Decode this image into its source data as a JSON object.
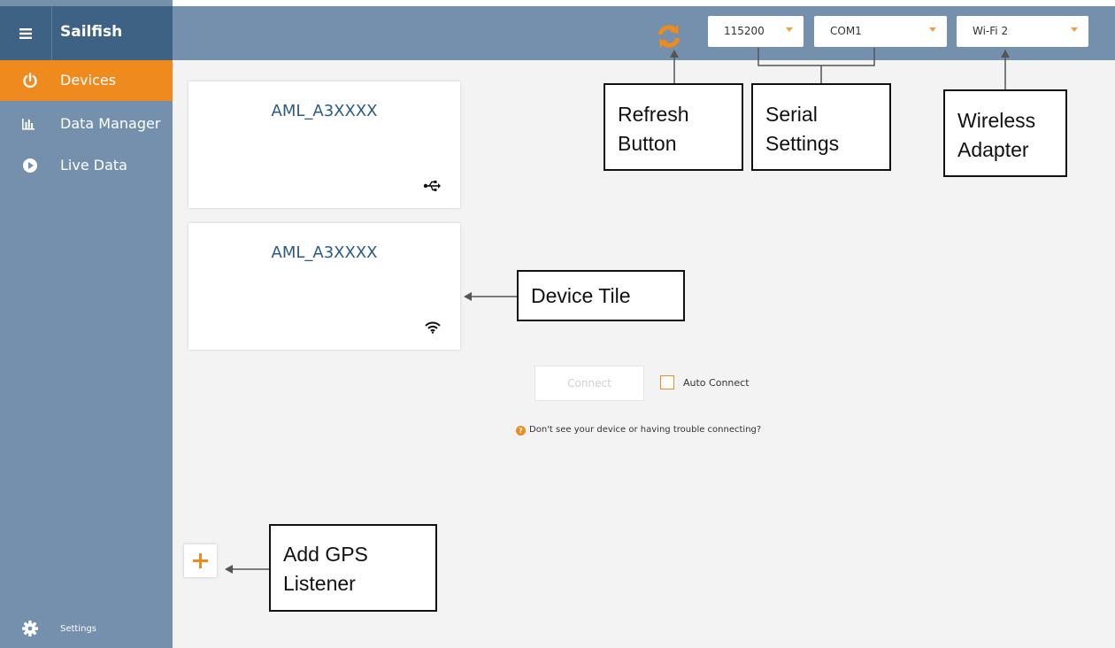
{
  "app": {
    "title": "Sailfish"
  },
  "sidebar": {
    "items": [
      {
        "label": "Devices",
        "icon": "power-icon",
        "active": true
      },
      {
        "label": "Data Manager",
        "icon": "bar-chart-icon",
        "active": false
      },
      {
        "label": "Live Data",
        "icon": "play-icon",
        "active": false
      }
    ],
    "settings_label": "Settings"
  },
  "toolbar": {
    "baud_rate": "115200",
    "com_port": "COM1",
    "wireless_adapter": "Wi-Fi 2"
  },
  "devices": [
    {
      "name": "AML_A3XXXX",
      "connection": "usb-icon"
    },
    {
      "name": "AML_A3XXXX",
      "connection": "wifi-icon"
    }
  ],
  "connect": {
    "button_label": "Connect",
    "auto_connect_label": "Auto Connect",
    "help_text": "Don't see your device or having trouble connecting?"
  },
  "annotations": {
    "refresh": [
      "Refresh",
      "Button"
    ],
    "serial": [
      "Serial",
      "Settings"
    ],
    "wireless": [
      "Wireless",
      "Adapter"
    ],
    "tile": [
      "Device Tile"
    ],
    "gps": [
      "Add GPS",
      "Listener"
    ]
  },
  "colors": {
    "accent": "#ef8a1e",
    "sidebar": "#7490ad",
    "header": "#3e6284",
    "content_bg": "#f3f3f3"
  }
}
